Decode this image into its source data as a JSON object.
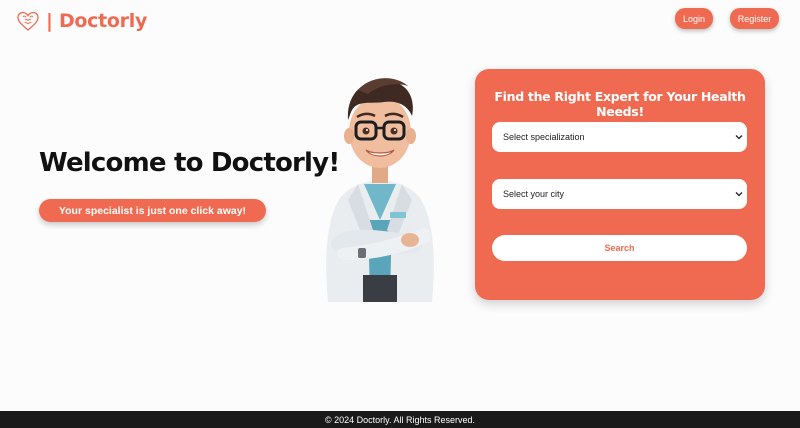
{
  "header": {
    "logo_text": "| Doctorly",
    "logo_icon": "brain-heart-icon",
    "login_label": "Login",
    "register_label": "Register"
  },
  "hero": {
    "title": "Welcome to Doctorly!",
    "tagline": "Your specialist is just one click away!"
  },
  "search_card": {
    "title": "Find the Right Expert for Your Health Needs!",
    "specialization_selected": "Select specialization",
    "city_selected": "Select your city",
    "search_label": "Search"
  },
  "footer": {
    "text": "© 2024 Doctorly. All Rights Reserved."
  },
  "colors": {
    "accent": "#ef6a50",
    "footer_bg": "#1a1a1a"
  }
}
